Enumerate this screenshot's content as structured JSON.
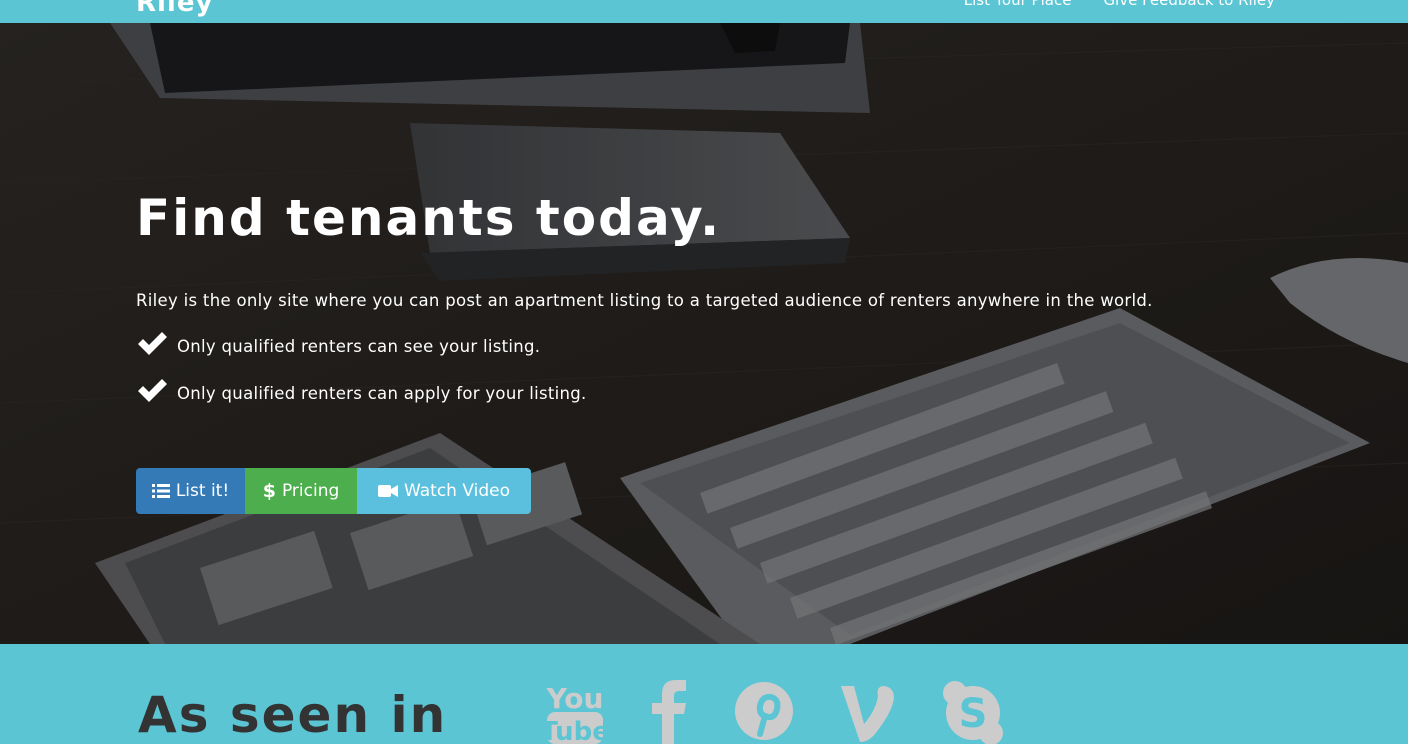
{
  "navbar": {
    "brand": "Riley",
    "links": [
      "List Your Place",
      "Give Feedback to Riley"
    ]
  },
  "hero": {
    "title": "Find tenants today.",
    "description": "Riley is the only site where you can post an apartment listing to a targeted audience of renters anywhere in the world.",
    "checks": [
      "Only qualified renters can see your listing.",
      "Only qualified renters can apply for your listing."
    ],
    "buttons": {
      "list": "List it!",
      "pricing": "Pricing",
      "video": "Watch Video"
    }
  },
  "seen_in": {
    "title": "As seen in",
    "icons": [
      "youtube-icon",
      "facebook-icon",
      "pinterest-icon",
      "vine-icon",
      "skype-icon"
    ]
  },
  "colors": {
    "accent": "#5bc5d4",
    "primary_button": "#337ab7",
    "success_button": "#4cae4c",
    "info_button": "#5bc0de",
    "heading_dark": "#333333",
    "icon_gray": "#cccccc"
  }
}
